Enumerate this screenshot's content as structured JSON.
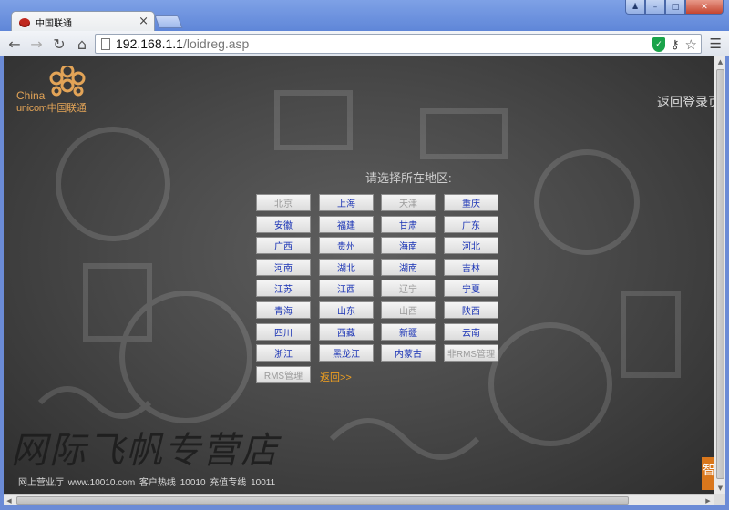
{
  "browser": {
    "tab_title": "中国联通",
    "tab_close": "×",
    "url_host": "192.168.1.1",
    "url_path": "/loidreg.asp",
    "window_buttons": {
      "user": "♟",
      "minimize": "–",
      "maximize": "□",
      "close": "✕"
    }
  },
  "page": {
    "logo": {
      "line1": "China",
      "line2": "unicom中国联通"
    },
    "back_login": "返回登录页",
    "prompt": "请选择所在地区:",
    "regions": [
      {
        "label": "北京",
        "enabled": false
      },
      {
        "label": "上海",
        "enabled": true
      },
      {
        "label": "天津",
        "enabled": false
      },
      {
        "label": "重庆",
        "enabled": true
      },
      {
        "label": "安徽",
        "enabled": true
      },
      {
        "label": "福建",
        "enabled": true
      },
      {
        "label": "甘肃",
        "enabled": true
      },
      {
        "label": "广东",
        "enabled": true
      },
      {
        "label": "广西",
        "enabled": true
      },
      {
        "label": "贵州",
        "enabled": true
      },
      {
        "label": "海南",
        "enabled": true
      },
      {
        "label": "河北",
        "enabled": true
      },
      {
        "label": "河南",
        "enabled": true
      },
      {
        "label": "湖北",
        "enabled": true
      },
      {
        "label": "湖南",
        "enabled": true
      },
      {
        "label": "吉林",
        "enabled": true
      },
      {
        "label": "江苏",
        "enabled": true
      },
      {
        "label": "江西",
        "enabled": true
      },
      {
        "label": "辽宁",
        "enabled": false
      },
      {
        "label": "宁夏",
        "enabled": true
      },
      {
        "label": "青海",
        "enabled": true
      },
      {
        "label": "山东",
        "enabled": true
      },
      {
        "label": "山西",
        "enabled": false
      },
      {
        "label": "陕西",
        "enabled": true
      },
      {
        "label": "四川",
        "enabled": true
      },
      {
        "label": "西藏",
        "enabled": true
      },
      {
        "label": "新疆",
        "enabled": true
      },
      {
        "label": "云南",
        "enabled": true
      },
      {
        "label": "浙江",
        "enabled": true
      },
      {
        "label": "黑龙江",
        "enabled": true
      },
      {
        "label": "内蒙古",
        "enabled": true
      },
      {
        "label": "非RMS管理",
        "enabled": false
      },
      {
        "label": "RMS管理",
        "enabled": false
      }
    ],
    "return_link": "返回>>",
    "watermark": "网际飞帆专营店",
    "footer": "网上营业厅 www.10010.com  客户热线 10010  充值专线 10011",
    "corner_badge": "智"
  },
  "colors": {
    "brand_orange": "#e3a457",
    "link_blue": "#1a33b5",
    "return_link": "#f0a020",
    "titlebar_blue": "#6b8bd6"
  }
}
